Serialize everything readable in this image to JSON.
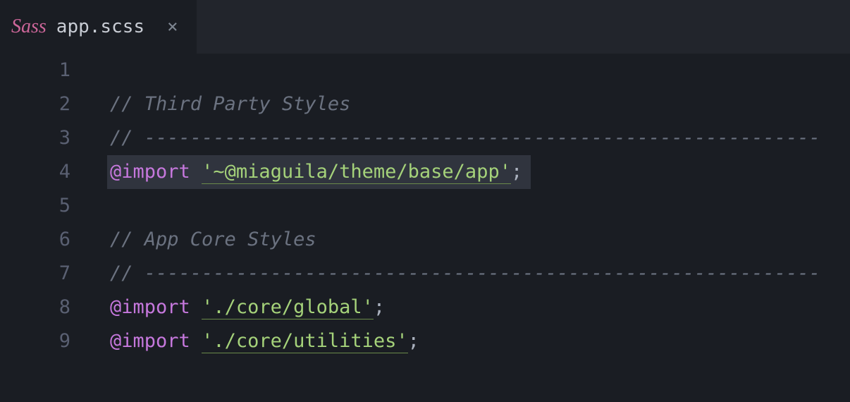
{
  "tab": {
    "filename": "app.scss",
    "close_glyph": "×",
    "icon_text": "Sass"
  },
  "lines": {
    "numbers": [
      "1",
      "2",
      "3",
      "4",
      "5",
      "6",
      "7",
      "8",
      "9"
    ],
    "comment_third_party": "// Third Party Styles",
    "divider": "// -----------------------------------------------------------",
    "kw_import": "@import",
    "str_theme": "'~@miaguila/theme/base/app'",
    "semicolon": ";",
    "comment_core": "// App Core Styles",
    "str_global": "'./core/global'",
    "str_utilities": "'./core/utilities'"
  }
}
